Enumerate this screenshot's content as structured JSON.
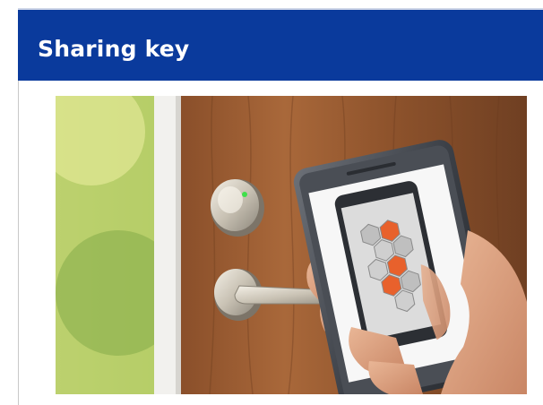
{
  "slide": {
    "title": "Sharing key"
  },
  "photo": {
    "subject": "smart-lock-door-with-smartphone"
  },
  "colors": {
    "title_bar": "#0a3a9c",
    "title_text": "#ffffff",
    "app_accent": "#e8612c"
  }
}
